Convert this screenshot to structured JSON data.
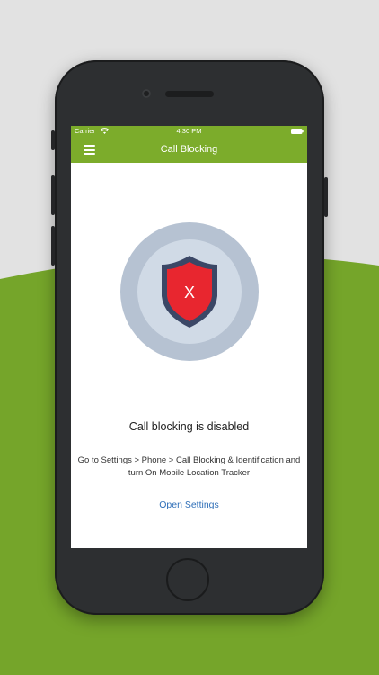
{
  "colors": {
    "accent_green": "#7cac2b",
    "link_blue": "#2f6fb8",
    "shield_fill": "#e8262f",
    "shield_outline": "#3b4766",
    "circle_outer": "#b6c2d2",
    "circle_inner": "#d0dae6"
  },
  "status_bar": {
    "carrier": "Carrier",
    "time": "4:30 PM",
    "wifi_icon": "wifi-icon",
    "battery_icon": "battery-icon"
  },
  "nav_bar": {
    "title": "Call Blocking",
    "menu_icon": "hamburger-menu-icon"
  },
  "content": {
    "shield_mark": "X",
    "headline": "Call blocking is disabled",
    "instructions": "Go to Settings > Phone > Call Blocking & Identification and turn On Mobile Location Tracker",
    "open_settings_label": "Open Settings"
  }
}
